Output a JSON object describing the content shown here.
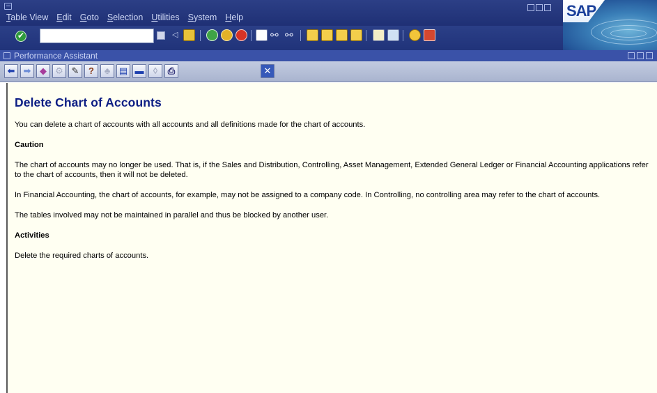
{
  "menubar": {
    "items": [
      "Table View",
      "Edit",
      "Goto",
      "Selection",
      "Utilities",
      "System",
      "Help"
    ],
    "brand": "SAP"
  },
  "toolbar": {
    "command_field_value": ""
  },
  "assistant": {
    "title": "Performance Assistant"
  },
  "document": {
    "heading": "Delete Chart of Accounts",
    "intro": "You can delete a chart of accounts with all accounts and all definitions made for the chart of accounts.",
    "caution_heading": "Caution",
    "caution_p1": "The chart of accounts may no longer be used. That is, if the Sales and Distribution, Controlling, Asset Management, Extended General Ledger or Financial Accounting applications refer to the chart of accounts, then it will not be deleted.",
    "caution_p2": "In Financial Accounting, the chart of accounts, for example, may not be assigned to a company code. In Controlling, no controlling area may refer to the chart of accounts.",
    "caution_p3": "The tables involved may not be maintained in parallel and thus be blocked by another user.",
    "activities_heading": "Activities",
    "activities_p1": "Delete the required charts of accounts."
  },
  "colors": {
    "title_bar": "#1f3075",
    "heading": "#0d1e84",
    "content_bg": "#fffff2"
  }
}
